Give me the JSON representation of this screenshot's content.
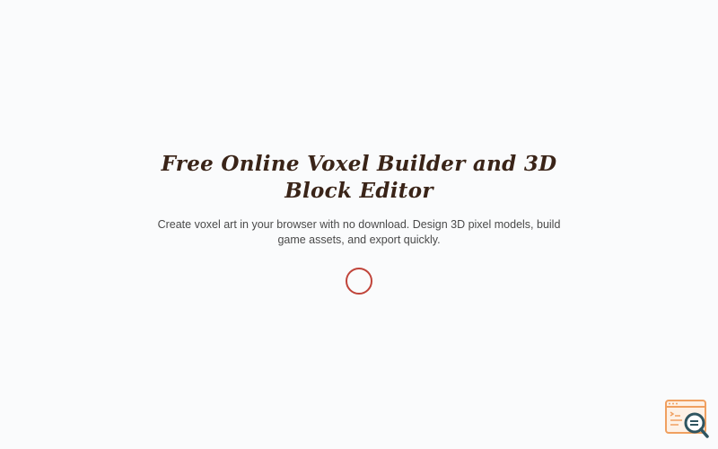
{
  "hero": {
    "title": "Free Online Voxel Builder and 3D Block Editor",
    "subtitle": "Create voxel art in your browser with no download. Design 3D pixel models, build game assets, and export quickly."
  },
  "loading": {
    "icon": "loading-spinner-icon",
    "color": "#c0443a"
  },
  "widget": {
    "icon": "browser-search-icon",
    "accent_color": "#f0a060",
    "lens_color": "#2f5560"
  }
}
